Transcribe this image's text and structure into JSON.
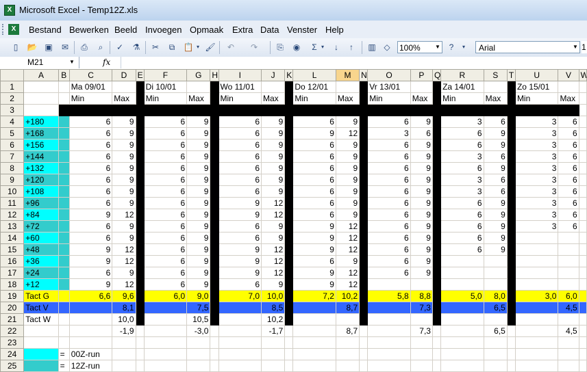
{
  "window": {
    "title": "Microsoft Excel - Temp12Z.xls"
  },
  "menu": [
    "Bestand",
    "Bewerken",
    "Beeld",
    "Invoegen",
    "Opmaak",
    "Extra",
    "Data",
    "Venster",
    "Help"
  ],
  "toolbar": {
    "zoom": "100%",
    "font": "Arial",
    "size": "1"
  },
  "formula_bar": {
    "cell_ref": "M21",
    "fx": "fx",
    "content": ""
  },
  "columns": [
    "A",
    "B",
    "C",
    "D",
    "E",
    "F",
    "G",
    "H",
    "I",
    "J",
    "K",
    "L",
    "M",
    "N",
    "O",
    "P",
    "Q",
    "R",
    "S",
    "T",
    "U",
    "V",
    "W"
  ],
  "days": [
    "Ma 09/01",
    "Di 10/01",
    "Wo 11/01",
    "Do 12/01",
    "Vr 13/01",
    "Za 14/01",
    "Zo 15/01"
  ],
  "minmax": [
    "Min",
    "Max"
  ],
  "labels": [
    "+180",
    "+168",
    "+156",
    "+144",
    "+132",
    "+120",
    "+108",
    "+96",
    "+84",
    "+72",
    "+60",
    "+48",
    "+36",
    "+24",
    "+12"
  ],
  "data": [
    [
      [
        6,
        9
      ],
      [
        6,
        9
      ],
      [
        6,
        9
      ],
      [
        6,
        9
      ],
      [
        6,
        9
      ],
      [
        3,
        6
      ],
      [
        3,
        6
      ]
    ],
    [
      [
        6,
        9
      ],
      [
        6,
        9
      ],
      [
        6,
        9
      ],
      [
        9,
        12
      ],
      [
        3,
        6
      ],
      [
        6,
        9
      ],
      [
        3,
        6
      ]
    ],
    [
      [
        6,
        9
      ],
      [
        6,
        9
      ],
      [
        6,
        9
      ],
      [
        6,
        9
      ],
      [
        6,
        9
      ],
      [
        6,
        9
      ],
      [
        3,
        6
      ]
    ],
    [
      [
        6,
        9
      ],
      [
        6,
        9
      ],
      [
        6,
        9
      ],
      [
        6,
        9
      ],
      [
        6,
        9
      ],
      [
        3,
        6
      ],
      [
        3,
        6
      ]
    ],
    [
      [
        6,
        9
      ],
      [
        6,
        9
      ],
      [
        6,
        9
      ],
      [
        6,
        9
      ],
      [
        6,
        9
      ],
      [
        6,
        9
      ],
      [
        3,
        6
      ]
    ],
    [
      [
        6,
        9
      ],
      [
        6,
        9
      ],
      [
        6,
        9
      ],
      [
        6,
        9
      ],
      [
        6,
        9
      ],
      [
        3,
        6
      ],
      [
        3,
        6
      ]
    ],
    [
      [
        6,
        9
      ],
      [
        6,
        9
      ],
      [
        6,
        9
      ],
      [
        6,
        9
      ],
      [
        6,
        9
      ],
      [
        3,
        6
      ],
      [
        3,
        6
      ]
    ],
    [
      [
        6,
        9
      ],
      [
        6,
        9
      ],
      [
        9,
        12
      ],
      [
        6,
        9
      ],
      [
        6,
        9
      ],
      [
        6,
        9
      ],
      [
        3,
        6
      ]
    ],
    [
      [
        9,
        12
      ],
      [
        6,
        9
      ],
      [
        9,
        12
      ],
      [
        6,
        9
      ],
      [
        6,
        9
      ],
      [
        6,
        9
      ],
      [
        3,
        6
      ]
    ],
    [
      [
        6,
        9
      ],
      [
        6,
        9
      ],
      [
        6,
        9
      ],
      [
        9,
        12
      ],
      [
        6,
        9
      ],
      [
        6,
        9
      ],
      [
        3,
        6
      ]
    ],
    [
      [
        6,
        9
      ],
      [
        6,
        9
      ],
      [
        6,
        9
      ],
      [
        9,
        12
      ],
      [
        6,
        9
      ],
      [
        6,
        9
      ],
      [
        "",
        ""
      ]
    ],
    [
      [
        9,
        12
      ],
      [
        6,
        9
      ],
      [
        9,
        12
      ],
      [
        9,
        12
      ],
      [
        6,
        9
      ],
      [
        6,
        9
      ],
      [
        "",
        ""
      ]
    ],
    [
      [
        9,
        12
      ],
      [
        6,
        9
      ],
      [
        9,
        12
      ],
      [
        6,
        9
      ],
      [
        6,
        9
      ],
      [
        "",
        ""
      ],
      [
        "",
        ""
      ]
    ],
    [
      [
        6,
        9
      ],
      [
        6,
        9
      ],
      [
        9,
        12
      ],
      [
        9,
        12
      ],
      [
        6,
        9
      ],
      [
        "",
        ""
      ],
      [
        "",
        ""
      ]
    ],
    [
      [
        9,
        12
      ],
      [
        6,
        9
      ],
      [
        6,
        9
      ],
      [
        9,
        12
      ],
      [
        "",
        ""
      ],
      [
        "",
        ""
      ],
      [
        "",
        ""
      ]
    ]
  ],
  "tact_g": {
    "label": "Tact G",
    "values": [
      [
        "6,6",
        "9,6"
      ],
      [
        "6,0",
        "9,0"
      ],
      [
        "7,0",
        "10,0"
      ],
      [
        "7,2",
        "10,2"
      ],
      [
        "5,8",
        "8,8"
      ],
      [
        "5,0",
        "8,0"
      ],
      [
        "3,0",
        "6,0"
      ]
    ]
  },
  "tact_v": {
    "label": "Tact V",
    "values": [
      "8,1",
      "7,5",
      "8,5",
      "8,7",
      "7,3",
      "6,5",
      "4,5"
    ]
  },
  "tact_w": {
    "label": "Tact W",
    "values": [
      "10,0",
      "10,5",
      "10,2",
      "",
      "",
      "",
      ""
    ]
  },
  "row22": [
    "-1,9",
    "-3,0",
    "-1,7",
    "8,7",
    "7,3",
    "6,5",
    "4,5"
  ],
  "legend": [
    {
      "eq": "=",
      "text": "00Z-run",
      "color": "#00ffff"
    },
    {
      "eq": "=",
      "text": "12Z-run",
      "color": "#33cccc"
    }
  ],
  "colors": {
    "cyan": "#00ffff",
    "teal": "#33cccc",
    "yellow": "#ffff00",
    "blue": "#3366ff",
    "black": "#000000"
  }
}
